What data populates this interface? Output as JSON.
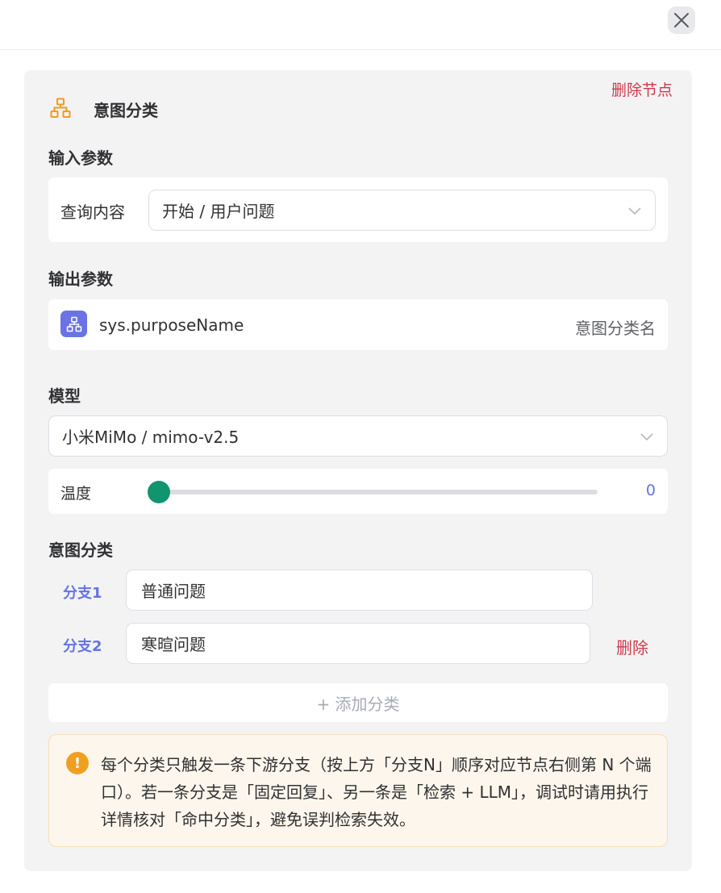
{
  "header": {
    "close_icon": "close-icon"
  },
  "node": {
    "delete_label": "删除节点",
    "icon": "org-tree-icon",
    "title": "意图分类"
  },
  "input_params": {
    "title": "输入参数",
    "query_label": "查询内容",
    "query_value": "开始 / 用户问题"
  },
  "output_params": {
    "title": "输出参数",
    "var_name": "sys.purposeName",
    "var_desc": "意图分类名"
  },
  "model": {
    "title": "模型",
    "selected": "小米MiMo / mimo-v2.5",
    "temperature_label": "温度",
    "temperature_value": "0"
  },
  "intent": {
    "title": "意图分类",
    "branches": [
      {
        "label": "分支1",
        "value": "普通问题"
      },
      {
        "label": "分支2",
        "value": "寒暄问题",
        "delete_label": "删除"
      }
    ],
    "add_label": "+ 添加分类"
  },
  "notice": {
    "icon": "warning-icon",
    "text": "每个分类只触发一条下游分支（按上方「分支N」顺序对应节点右侧第 N 个端口）。若一条分支是「固定回复」、另一条是「检索 + LLM」，调试时请用执行详情核对「命中分类」，避免误判检索失效。"
  },
  "colors": {
    "accent": "#6474e4",
    "danger": "#d0384a",
    "slider": "#12956f",
    "node_icon": "#f29a1f",
    "warning": "#f0a020"
  }
}
